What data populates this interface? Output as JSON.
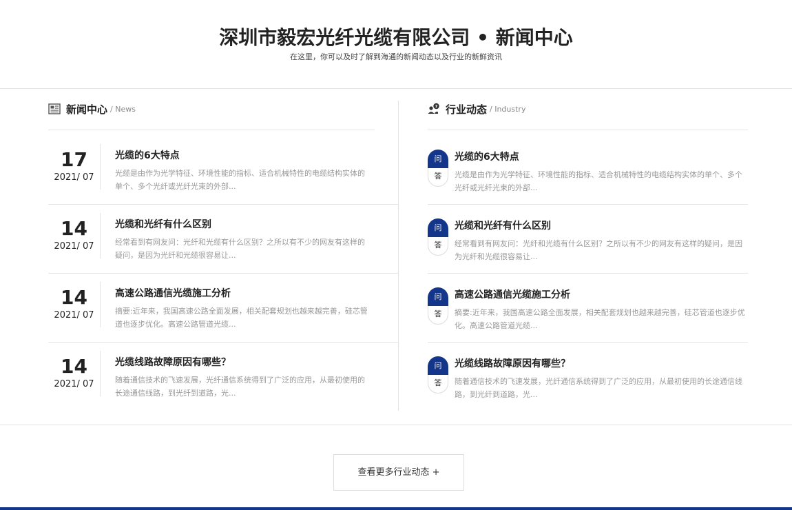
{
  "header": {
    "title": "深圳市毅宏光纤光缆有限公司 • 新闻中心",
    "subtitle": "在这里，你可以及时了解到海通的新闻动态以及行业的新鲜资讯"
  },
  "news": {
    "title": "新闻中心",
    "en": "/ News",
    "icon": "newspaper-icon",
    "items": [
      {
        "day": "17",
        "ym": "2021/  07",
        "title": "光缆的6大特点",
        "desc": "光缆是由作为光学特征、环境性能的指标、适合机械特性的电缆结构实体的单个、多个光纤或光纤光束的外部..."
      },
      {
        "day": "14",
        "ym": "2021/  07",
        "title": "光缆和光纤有什么区别",
        "desc": "经常看到有网友问：光纤和光缆有什么区别？之所以有不少的网友有这样的疑问，是因为光纤和光缆很容易让..."
      },
      {
        "day": "14",
        "ym": "2021/  07",
        "title": "高速公路通信光缆施工分析",
        "desc": "摘要:近年来，我国高速公路全面发展，相关配套规划也越来越完善，硅芯管道也逐步优化。高速公路管道光缆..."
      },
      {
        "day": "14",
        "ym": "2021/  07",
        "title": "光缆线路故障原因有哪些？",
        "desc": "随着通信技术的飞速发展，光纤通信系统得到了广泛的应用，从最初使用的长途通信线路，到光纤到道路，光..."
      }
    ]
  },
  "industry": {
    "title": "行业动态",
    "en": "/ Industry",
    "icon": "users-question-icon",
    "q_label": "问",
    "a_label": "答",
    "items": [
      {
        "title": "光缆的6大特点",
        "desc": "光缆是由作为光学特征、环境性能的指标、适合机械特性的电缆结构实体的单个、多个光纤或光纤光束的外部..."
      },
      {
        "title": "光缆和光纤有什么区别",
        "desc": "经常看到有网友问：光纤和光缆有什么区别？之所以有不少的网友有这样的疑问，是因为光纤和光缆很容易让..."
      },
      {
        "title": "高速公路通信光缆施工分析",
        "desc": "摘要:近年来，我国高速公路全面发展，相关配套规划也越来越完善，硅芯管道也逐步优化。高速公路管道光缆..."
      },
      {
        "title": "光缆线路故障原因有哪些？",
        "desc": "随着通信技术的飞速发展，光纤通信系统得到了广泛的应用，从最初使用的长途通信线路，到光纤到道路，光..."
      }
    ]
  },
  "more_button": "查看更多行业动态 +",
  "colors": {
    "accent": "#13358a",
    "divider": "#e3e3e3",
    "muted_text": "#999999"
  }
}
